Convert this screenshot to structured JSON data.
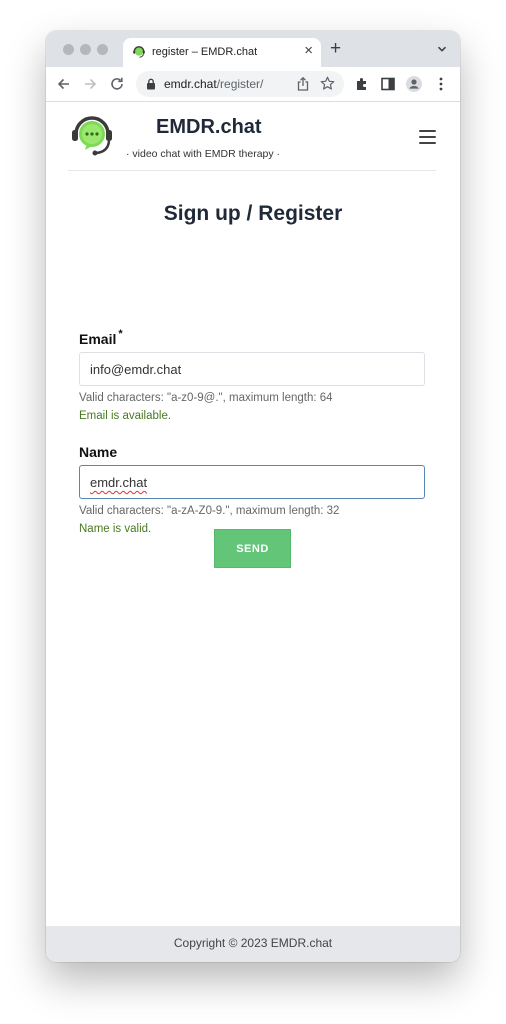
{
  "browser": {
    "tab_title": "register – EMDR.chat",
    "close_symbol": "×",
    "new_tab_symbol": "+",
    "url_host": "emdr.chat",
    "url_path": "/register/"
  },
  "header": {
    "site_title": "EMDR.chat",
    "tagline": "· video chat with EMDR therapy ·"
  },
  "main": {
    "page_title": "Sign up / Register",
    "email": {
      "label": "Email",
      "required_marker": "*",
      "value": "info@emdr.chat",
      "hint": "Valid characters: \"a-z0-9@.\", maximum length: 64",
      "status": "Email is available."
    },
    "name": {
      "label": "Name",
      "value": "emdr.chat",
      "hint": "Valid characters: \"a-zA-Z0-9.\", maximum length: 32",
      "status": "Name is valid."
    },
    "send_label": "SEND"
  },
  "footer": {
    "copyright": "Copyright © 2023 EMDR.chat"
  },
  "colors": {
    "send_button": "#63c578",
    "status_ok": "#4a7a23",
    "logo_green": "#7ed957",
    "logo_dark": "#3a3a3a"
  },
  "icons": [
    "back-icon",
    "forward-icon",
    "reload-icon",
    "lock-icon",
    "share-icon",
    "star-icon",
    "extensions-icon",
    "side-panel-icon",
    "profile-icon",
    "more-icon",
    "hamburger-icon",
    "logo-icon"
  ]
}
